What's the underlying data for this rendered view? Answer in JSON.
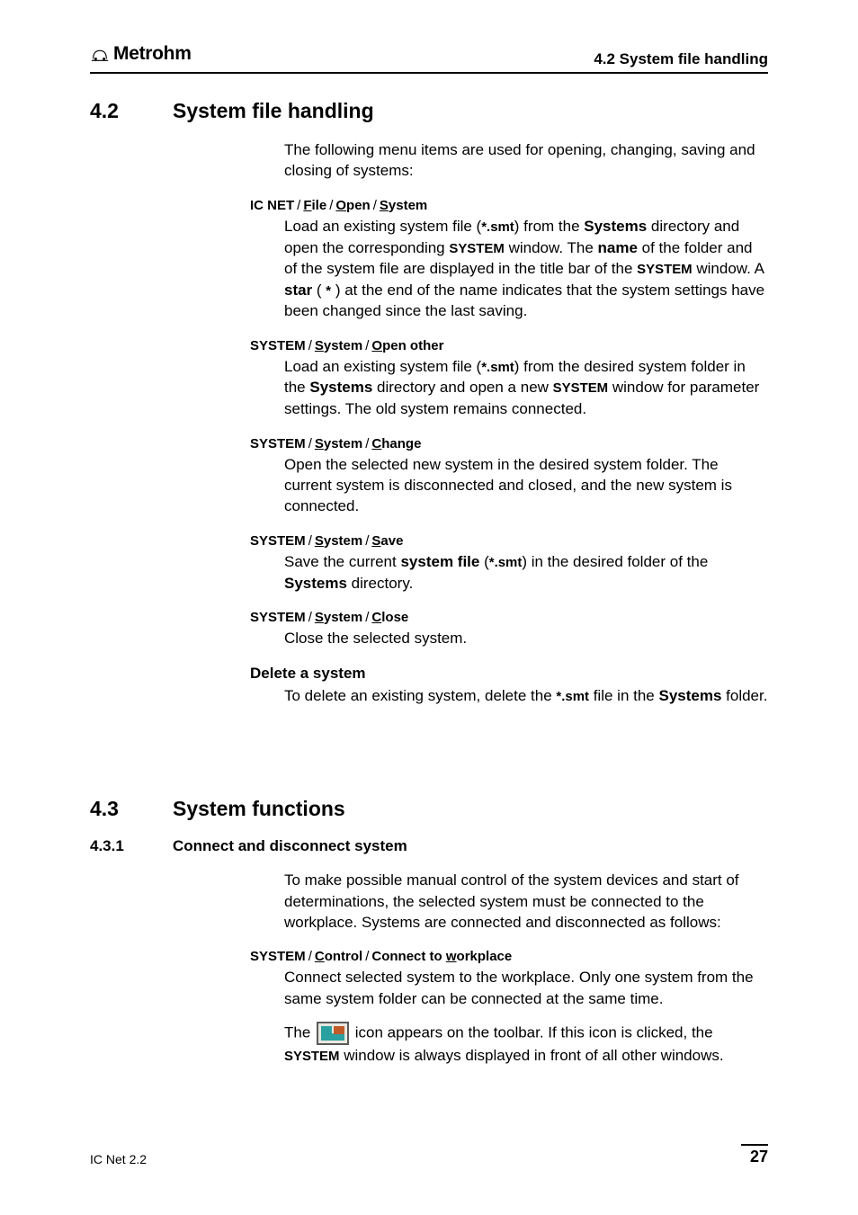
{
  "header": {
    "brand": "Metrohm",
    "right": "4.2 System file handling"
  },
  "section42": {
    "num": "4.2",
    "title": "System file handling",
    "intro": "The following menu items are used for opening, changing, saving and closing of systems:"
  },
  "items42": [
    {
      "path": [
        {
          "u": "",
          "t": "IC NET"
        },
        {
          "u": "F",
          "t": "ile"
        },
        {
          "u": "O",
          "t": "pen"
        },
        {
          "u": "S",
          "t": "ystem"
        }
      ],
      "desc_html": "Load an existing system file (<span class=\"sc\">*.smt</span>) from the <span class=\"b\">Systems</span> directory and open the corresponding <span class=\"sc\">SYSTEM</span> window. The <span class=\"b\">name</span> of the folder and of the system file are displayed in the title bar of the <span class=\"sc\">SYSTEM</span> window. A <span class=\"b\">star</span> ( <span class=\"starpar\">*</span> ) at the end of the name indicates that the system settings have been changed since the last saving."
    },
    {
      "path": [
        {
          "u": "",
          "t": "SYSTEM"
        },
        {
          "u": "S",
          "t": "ystem"
        },
        {
          "u": "O",
          "t": "pen other"
        }
      ],
      "desc_html": "Load an existing system file (<span class=\"sc\">*.smt</span>) from the desired system folder in the <span class=\"b\">Systems</span> directory and open a new <span class=\"sc\">SYSTEM</span> window for parameter settings. The old system remains connected."
    },
    {
      "path": [
        {
          "u": "",
          "t": "SYSTEM"
        },
        {
          "u": "S",
          "t": "ystem"
        },
        {
          "u": "C",
          "t": "hange"
        }
      ],
      "desc_html": "Open the selected new system in the desired system folder. The current system is disconnected and closed, and the new system is connected."
    },
    {
      "path": [
        {
          "u": "",
          "t": "SYSTEM"
        },
        {
          "u": "S",
          "t": "ystem"
        },
        {
          "u": "S",
          "t": "ave"
        }
      ],
      "desc_html": "Save the current <span class=\"b\">system file</span> (<span class=\"sc\">*.smt</span>) in the desired folder of the <span class=\"b\">Systems</span> directory."
    },
    {
      "path": [
        {
          "u": "",
          "t": "SYSTEM"
        },
        {
          "u": "S",
          "t": "ystem"
        },
        {
          "u": "C",
          "t": "lose"
        }
      ],
      "desc_html": "Close the selected system."
    }
  ],
  "delete_item": {
    "title": "Delete a system",
    "desc_html": "To delete an existing system, delete the <span class=\"sc\">*.smt</span> file in the <span class=\"b\">Systems</span> folder."
  },
  "section43": {
    "num": "4.3",
    "title": "System functions"
  },
  "sub431": {
    "num": "4.3.1",
    "title": "Connect and disconnect system",
    "intro": "To make possible manual control of the system devices and start of determinations, the selected system must be connected to the workplace. Systems are connected and disconnected as follows:"
  },
  "items43": [
    {
      "path": [
        {
          "u": "",
          "t": "SYSTEM"
        },
        {
          "u": "C",
          "t": "ontrol"
        },
        {
          "u": "",
          "t": "Connect to ",
          "post_u": "w",
          "post_t": "orkplace"
        }
      ],
      "desc_html": "Connect selected system to the workplace. Only one system from the same system folder can be connected at the same time.",
      "desc2_pre": "The ",
      "desc2_post_html": " icon appears on the toolbar. If this icon is clicked, the <span class=\"sc\">SYSTEM</span> window is always displayed in front of all other windows."
    }
  ],
  "footer": {
    "left": "IC Net 2.2",
    "page": "27"
  }
}
